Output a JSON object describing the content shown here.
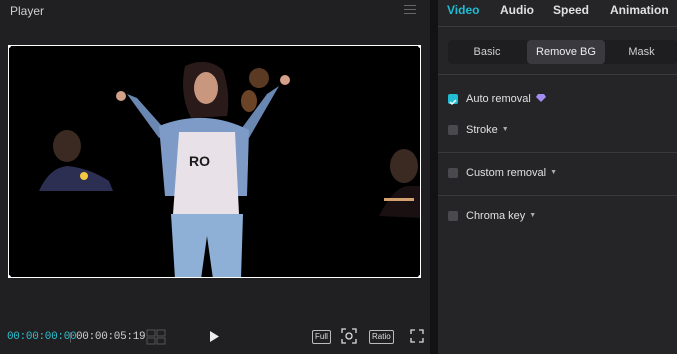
{
  "player": {
    "title": "Player",
    "timecode_current": "00:00:00:00",
    "timecode_separator": "|",
    "timecode_total": "00:00:05:19",
    "full_label": "Full",
    "ratio_label": "Ratio"
  },
  "panel": {
    "tabs": [
      {
        "label": "Video",
        "active": true
      },
      {
        "label": "Audio",
        "active": false
      },
      {
        "label": "Speed",
        "active": false
      },
      {
        "label": "Animation",
        "active": false
      }
    ],
    "subtabs": [
      {
        "label": "Basic",
        "active": false
      },
      {
        "label": "Remove BG",
        "active": true
      },
      {
        "label": "Mask",
        "active": false
      }
    ],
    "options": [
      {
        "label": "Auto removal",
        "checked": true,
        "premium": true
      },
      {
        "label": "Stroke",
        "checked": false,
        "dropdown": true
      },
      {
        "label": "Custom removal",
        "checked": false,
        "dropdown": true
      },
      {
        "label": "Chroma key",
        "checked": false,
        "dropdown": true
      }
    ]
  },
  "colors": {
    "accent": "#1fbcd2",
    "background": "#1e1e1e",
    "panel": "#252528"
  }
}
